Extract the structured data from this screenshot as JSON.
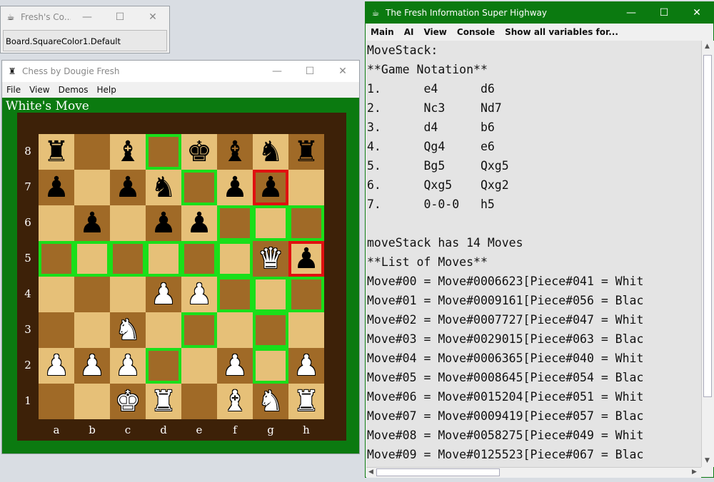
{
  "console_window": {
    "title": "Fresh's Co...",
    "field_value": "Board.SquareColor1.Default"
  },
  "chess_window": {
    "title": "Chess by Dougie Fresh",
    "menu": [
      "File",
      "View",
      "Demos",
      "Help"
    ],
    "status": "White's Move",
    "ranks": [
      "8",
      "7",
      "6",
      "5",
      "4",
      "3",
      "2",
      "1"
    ],
    "files": [
      "a",
      "b",
      "c",
      "d",
      "e",
      "f",
      "g",
      "h"
    ],
    "board": [
      [
        "r",
        "",
        "b",
        "",
        "k",
        "b",
        "n",
        "r"
      ],
      [
        "p",
        "",
        "p",
        "n",
        "",
        "p",
        "p",
        ""
      ],
      [
        "",
        "p",
        "",
        "p",
        "p",
        "",
        "",
        ""
      ],
      [
        "",
        "",
        "",
        "",
        "",
        "",
        "Q",
        "p"
      ],
      [
        "",
        "",
        "",
        "P",
        "P",
        "",
        "",
        ""
      ],
      [
        "",
        "",
        "N",
        "",
        "",
        "",
        "",
        ""
      ],
      [
        "P",
        "P",
        "P",
        "",
        "",
        "P",
        "",
        "P"
      ],
      [
        "",
        "",
        "K",
        "R",
        "",
        "B",
        "N",
        "R"
      ]
    ],
    "highlights_green": [
      "d8",
      "e7",
      "f6",
      "g6",
      "h6",
      "a5",
      "b5",
      "c5",
      "d5",
      "e5",
      "f5",
      "f4",
      "g4",
      "h4",
      "e3",
      "g3",
      "d2",
      "g2"
    ],
    "highlights_red": [
      "g7",
      "h5"
    ],
    "colors": {
      "frame": "#0b7a10",
      "board_border": "#3d2108",
      "light_square": "#e6c078",
      "dark_square": "#a06a27",
      "highlight_green": "#1adf1a",
      "highlight_red": "#e01010"
    }
  },
  "info_window": {
    "title": "The Fresh Information Super Highway",
    "menu": [
      "Main",
      "AI",
      "View",
      "Console",
      "Show all variables for..."
    ],
    "lines": [
      "MoveStack:",
      "**Game Notation**",
      "1.      e4      d6",
      "2.      Nc3     Nd7",
      "3.      d4      b6",
      "4.      Qg4     e6",
      "5.      Bg5     Qxg5",
      "6.      Qxg5    Qxg2",
      "7.      0-0-0   h5",
      "",
      "moveStack has 14 Moves",
      "**List of Moves**",
      "Move#00 = Move#0006623[Piece#041 = Whit",
      "Move#01 = Move#0009161[Piece#056 = Blac",
      "Move#02 = Move#0007727[Piece#047 = Whit",
      "Move#03 = Move#0029015[Piece#063 = Blac",
      "Move#04 = Move#0006365[Piece#040 = Whit",
      "Move#05 = Move#0008645[Piece#054 = Blac",
      "Move#06 = Move#0015204[Piece#051 = Whit",
      "Move#07 = Move#0009419[Piece#057 = Blac",
      "Move#08 = Move#0058275[Piece#049 = Whit",
      "Move#09 = Move#0125523[Piece#067 = Blac"
    ]
  },
  "window_buttons": {
    "minimize": "—",
    "maximize": "☐",
    "close": "✕"
  }
}
